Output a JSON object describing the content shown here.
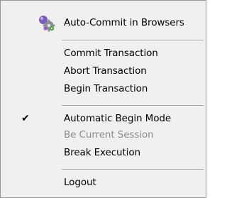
{
  "menu": {
    "items": [
      {
        "label": "Auto-Commit in Browsers",
        "icon": "transaction-gears-icon",
        "enabled": true
      },
      {
        "label": "Commit Transaction",
        "enabled": true
      },
      {
        "label": "Abort Transaction",
        "enabled": true
      },
      {
        "label": "Begin Transaction",
        "enabled": true
      },
      {
        "label": "Automatic Begin Mode",
        "checked": true,
        "check_glyph": "✔",
        "enabled": true
      },
      {
        "label": "Be Current Session",
        "enabled": false
      },
      {
        "label": "Break Execution",
        "enabled": true
      },
      {
        "label": "Logout",
        "enabled": true
      }
    ]
  },
  "colors": {
    "menu_background": "#f0f0f0",
    "menu_border": "#979797",
    "disabled_text": "#8b8b8b",
    "separator": "#a0a0a0"
  }
}
